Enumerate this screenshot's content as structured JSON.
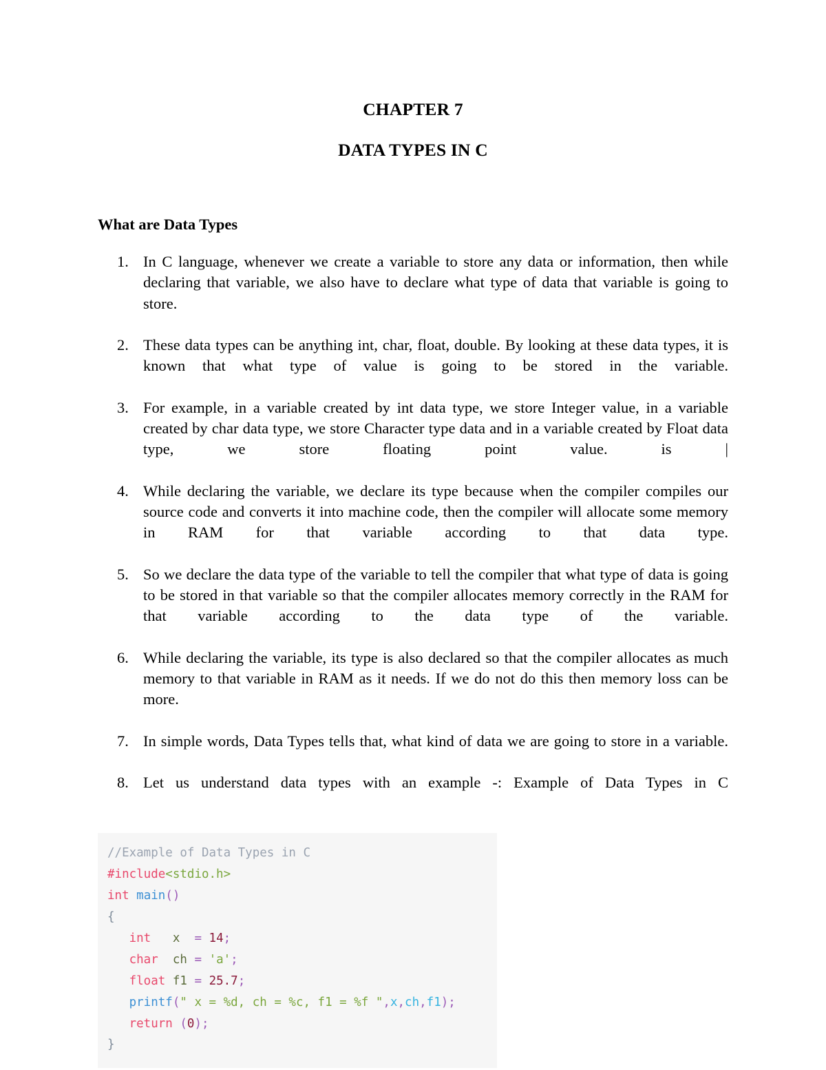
{
  "document": {
    "chapter_title": "CHAPTER 7",
    "subject_title": "DATA TYPES IN C",
    "section_heading": "What are Data Types",
    "points": [
      {
        "number": "1.",
        "text": "In C language, whenever we create a variable to store any data or information, then while declaring that variable, we also have to declare what type of data that variable is going to store."
      },
      {
        "number": "2.",
        "text": "These data types can be anything int, char, float, double. By looking at these data types, it is known that what type of value is going to be stored in the variable."
      },
      {
        "number": "3.",
        "text": "For example, in a variable created by int data type, we store Integer value, in a variable created by char data type, we store Character type data and in a variable created by Float data type, we store floating point value. is |"
      },
      {
        "number": "4.",
        "text": "While declaring the variable, we declare its type because when the compiler compiles our source code and converts it into machine code, then the compiler will allocate some memory in RAM for that variable according to that data type."
      },
      {
        "number": "5.",
        "text": "So we declare the data type of the variable to tell the compiler that what type of data is going to be stored in that variable so that the compiler allocates memory correctly in the RAM for that variable according to the data type of the variable."
      },
      {
        "number": "6.",
        "text": "While declaring the variable, its type is also declared so that the compiler allocates as much memory to that variable in RAM as it needs. If we do not do this then memory loss can be more."
      },
      {
        "number": "7.",
        "text": "In simple words, Data Types tells that, what kind of data we are going to store in a variable."
      },
      {
        "number": "8.",
        "text": "Let us understand data types with an example -: Example of Data Types in C"
      }
    ],
    "code_block": {
      "language": "c",
      "background_color": "#f6f6f6",
      "plain_text": "//Example of Data Types in C\n#include<stdio.h>\nint main()\n{\n   int   x  = 14;\n   char  ch = 'a';\n   float f1 = 25.7;\n   printf(\" x = %d, ch = %c, f1 = %f \",x,ch,f1);\n   return (0);\n}",
      "lines": [
        {
          "id": "line-1",
          "text": "//Example of Data Types in C"
        },
        {
          "id": "line-2",
          "text": "#include<stdio.h>"
        },
        {
          "id": "line-3",
          "text": "int main()"
        },
        {
          "id": "line-4",
          "text": "{"
        },
        {
          "id": "line-5",
          "text": "   int   x  = 14;"
        },
        {
          "id": "line-6",
          "text": "   char  ch = 'a';"
        },
        {
          "id": "line-7",
          "text": "   float f1 = 25.7;"
        },
        {
          "id": "line-8",
          "text": "   printf(\" x = %d, ch = %c, f1 = %f \",x,ch,f1);"
        },
        {
          "id": "line-9",
          "text": "   return (0);"
        },
        {
          "id": "line-10",
          "text": "}"
        }
      ],
      "tokens": {
        "comment": "//Example of Data Types in C",
        "preproc": "#include",
        "header": "<stdio.h>",
        "kw_int": "int",
        "fn_main": "main",
        "parens_main": "()",
        "brace_open": "{",
        "brace_close": "}",
        "kw_char": "char",
        "kw_float": "float",
        "kw_return": "return",
        "fn_printf": "printf",
        "var_x": "x",
        "var_ch": "ch",
        "var_f1": "f1",
        "num_14": "14",
        "num_25_7": "25.7",
        "num_0": "0",
        "char_a": "'a'",
        "format_string": "\" x = %d, ch = %c, f1 = %f \"",
        "assign": "=",
        "semicolon": ";"
      },
      "colors": {
        "comment": "#9aa3b0",
        "keyword": "#e8486b",
        "header": "#7aa63c",
        "function": "#3b8fd4",
        "punctuation": "#9b59b6",
        "string": "#7aa63c",
        "number": "#8b1a3a",
        "variable": "#5a6b3a",
        "argument": "#35b3e0",
        "brace": "#7f8c9a"
      }
    }
  }
}
